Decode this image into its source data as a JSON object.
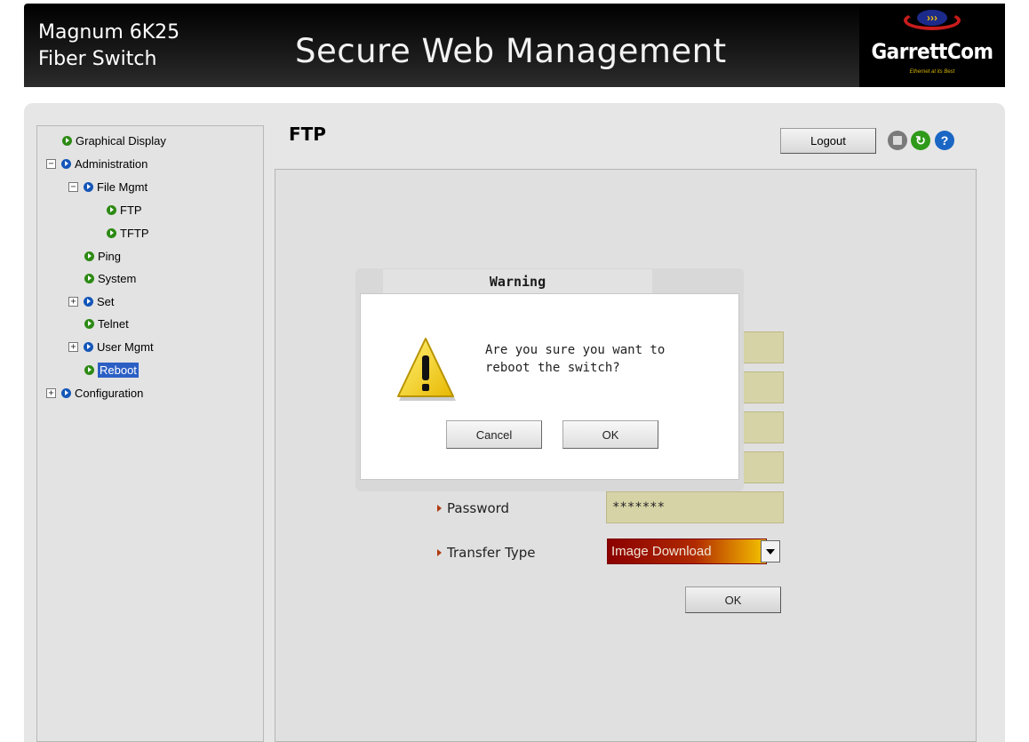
{
  "header": {
    "product_line1": "Magnum 6K25",
    "product_line2": "Fiber Switch",
    "title": "Secure Web Management",
    "logo_text": "GarrettCom",
    "logo_tagline": "Ethernet at its Best"
  },
  "sidebar": {
    "items": [
      {
        "label": "Graphical Display"
      },
      {
        "label": "Administration",
        "expander": "⊟"
      },
      {
        "label": "File Mgmt",
        "expander": "⊟"
      },
      {
        "label": "FTP"
      },
      {
        "label": "TFTP"
      },
      {
        "label": "Ping"
      },
      {
        "label": "System"
      },
      {
        "label": "Set",
        "expander": "⊞"
      },
      {
        "label": "Telnet"
      },
      {
        "label": "User Mgmt",
        "expander": "⊞"
      },
      {
        "label": "Reboot",
        "selected": true
      },
      {
        "label": "Configuration",
        "expander": "⊞"
      }
    ]
  },
  "page": {
    "title": "FTP",
    "logout_label": "Logout",
    "icons": [
      "save-icon",
      "refresh-icon",
      "help-icon"
    ]
  },
  "form": {
    "password_label": "Password",
    "password_value": "*******",
    "transfer_type_label": "Transfer Type",
    "transfer_type_value": "Image Download",
    "ok_label": "OK"
  },
  "dialog": {
    "title": "Warning",
    "message": "Are you sure you want to reboot the switch?",
    "cancel_label": "Cancel",
    "ok_label": "OK"
  },
  "colors": {
    "header_bg": "#000000",
    "panel_bg": "#e6e6e6",
    "field_bg": "#d6d3a6",
    "selected_bg": "#2c5fc4",
    "bullet_green": "#2c8a14",
    "bullet_blue": "#1456b8"
  }
}
